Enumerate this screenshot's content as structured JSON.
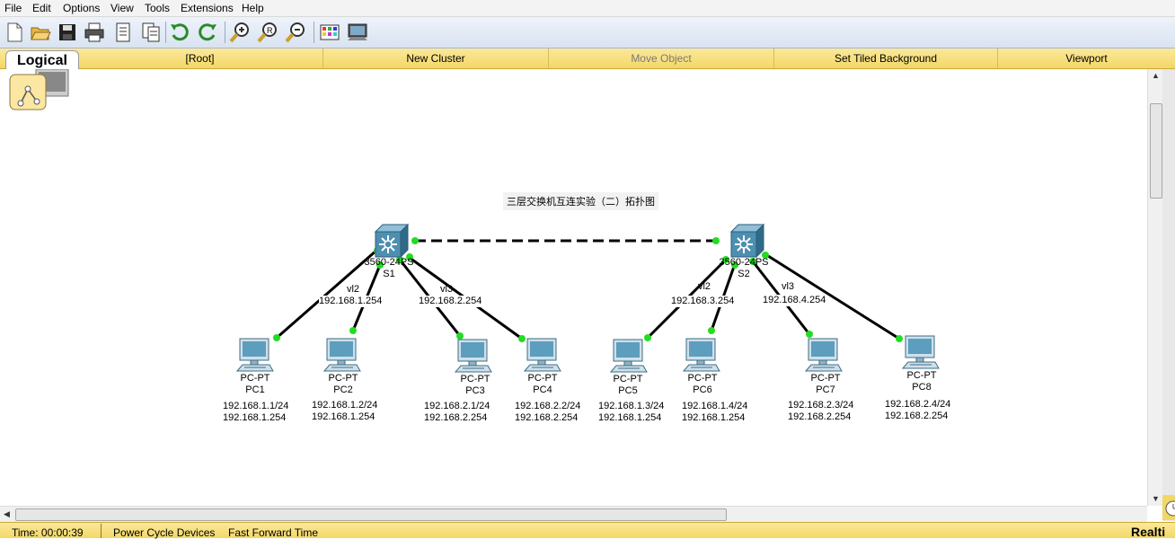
{
  "menu": [
    "File",
    "Edit",
    "Options",
    "View",
    "Tools",
    "Extensions",
    "Help"
  ],
  "toolbar": {
    "icons": [
      "new-file-icon",
      "open-folder-icon",
      "save-icon",
      "print-icon",
      "activity-wizard-icon",
      "copy-icon",
      "undo-icon",
      "redo-icon",
      "zoom-in-icon",
      "zoom-reset-icon",
      "zoom-out-icon",
      "palette-icon",
      "custom-device-icon"
    ]
  },
  "workspace": {
    "tab": "Logical",
    "buttons": [
      "[Root]",
      "New Cluster",
      "Move Object",
      "Set Tiled Background",
      "Viewport"
    ],
    "disabled": [
      "Move Object"
    ]
  },
  "diagram": {
    "title": "三层交换机互连实验（二）拓扑图",
    "switches": [
      {
        "model": "3560-24PS",
        "name": "S1"
      },
      {
        "model": "3560-24PS",
        "name": "S2"
      }
    ],
    "vlan_labels": [
      {
        "vlan": "vl2",
        "ip": "192.168.1.254"
      },
      {
        "vlan": "vl3",
        "ip": "192.168.2.254"
      },
      {
        "vlan": "vl2",
        "ip": "192.168.3.254"
      },
      {
        "vlan": "vl3",
        "ip": "192.168.4.254"
      }
    ],
    "pcs": [
      {
        "type": "PC-PT",
        "name": "PC1",
        "ip": "192.168.1.1/24",
        "gw": "192.168.1.254"
      },
      {
        "type": "PC-PT",
        "name": "PC2",
        "ip": "192.168.1.2/24",
        "gw": "192.168.1.254"
      },
      {
        "type": "PC-PT",
        "name": "PC3",
        "ip": "192.168.2.1/24",
        "gw": "192.168.2.254"
      },
      {
        "type": "PC-PT",
        "name": "PC4",
        "ip": "192.168.2.2/24",
        "gw": "192.168.2.254"
      },
      {
        "type": "PC-PT",
        "name": "PC5",
        "ip": "192.168.1.3/24",
        "gw": "192.168.1.254"
      },
      {
        "type": "PC-PT",
        "name": "PC6",
        "ip": "192.168.1.4/24",
        "gw": "192.168.1.254"
      },
      {
        "type": "PC-PT",
        "name": "PC7",
        "ip": "192.168.2.3/24",
        "gw": "192.168.2.254"
      },
      {
        "type": "PC-PT",
        "name": "PC8",
        "ip": "192.168.2.4/24",
        "gw": "192.168.2.254"
      }
    ]
  },
  "status": {
    "time_label": "Time: 00:00:39",
    "power_cycle": "Power Cycle Devices",
    "fast_forward": "Fast Forward Time",
    "mode": "Realti"
  },
  "colors": {
    "accent_yellow": "#f3d766",
    "link_up": "#22cc22",
    "switch_blue": "#3f7f9f"
  }
}
